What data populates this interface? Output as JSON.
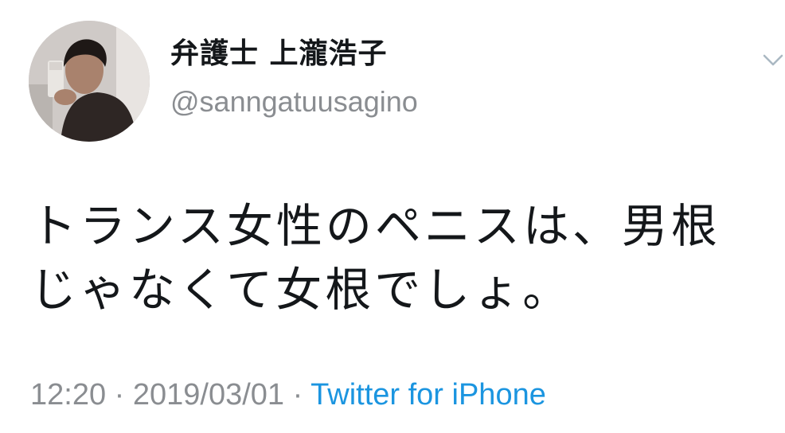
{
  "tweet": {
    "display_name": "弁護士 上瀧浩子",
    "handle": "@sanngatuusagino",
    "text": "トランス女性のペニスは、男根\nじゃなくて女根でしょ。",
    "time": "12:20",
    "separator": "·",
    "date": "2019/03/01",
    "source": "Twitter for iPhone",
    "menu_icon": "chevron-down-icon",
    "colors": {
      "text": "#14171a",
      "secondary": "#8a8d91",
      "link": "#1b95e0"
    }
  }
}
